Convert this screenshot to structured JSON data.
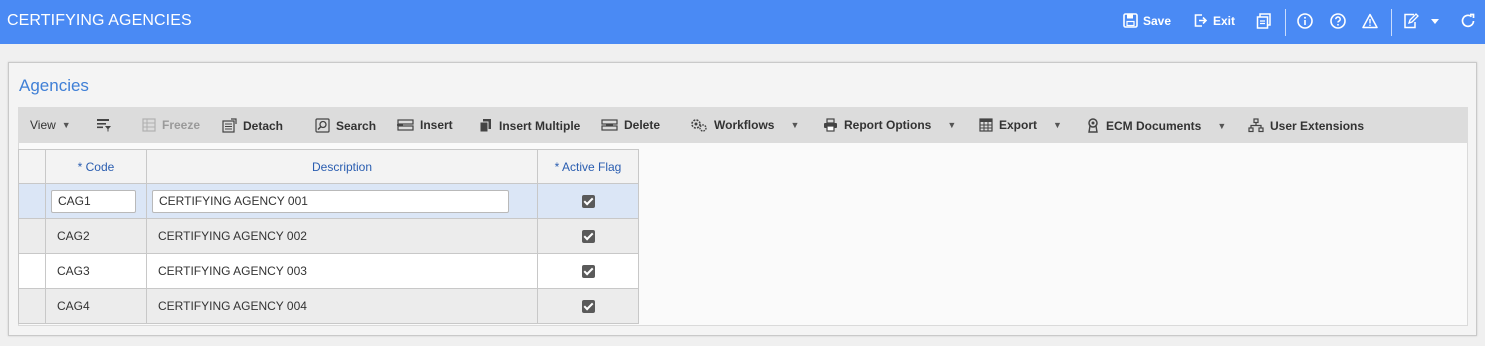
{
  "header": {
    "title": "CERTIFYING AGENCIES",
    "save_label": "Save",
    "exit_label": "Exit"
  },
  "panel": {
    "title": "Agencies"
  },
  "toolbar": {
    "view_label": "View",
    "freeze_label": "Freeze",
    "detach_label": "Detach",
    "search_label": "Search",
    "insert_label": "Insert",
    "insert_multiple_label": "Insert Multiple",
    "delete_label": "Delete",
    "workflows_label": "Workflows",
    "report_options_label": "Report Options",
    "export_label": "Export",
    "ecm_documents_label": "ECM Documents",
    "user_extensions_label": "User Extensions"
  },
  "table": {
    "columns": [
      "* Code",
      "Description",
      "* Active Flag"
    ],
    "rows": [
      {
        "code": "CAG1",
        "description": "CERTIFYING AGENCY 001",
        "active": true
      },
      {
        "code": "CAG2",
        "description": "CERTIFYING AGENCY 002",
        "active": true
      },
      {
        "code": "CAG3",
        "description": "CERTIFYING AGENCY 003",
        "active": true
      },
      {
        "code": "CAG4",
        "description": "CERTIFYING AGENCY 004",
        "active": true
      }
    ]
  },
  "colors": {
    "header_bg": "#4a8af4",
    "panel_title": "#3f7fd6",
    "column_header_text": "#2a5db0",
    "selected_row": "#dbe6f6"
  }
}
